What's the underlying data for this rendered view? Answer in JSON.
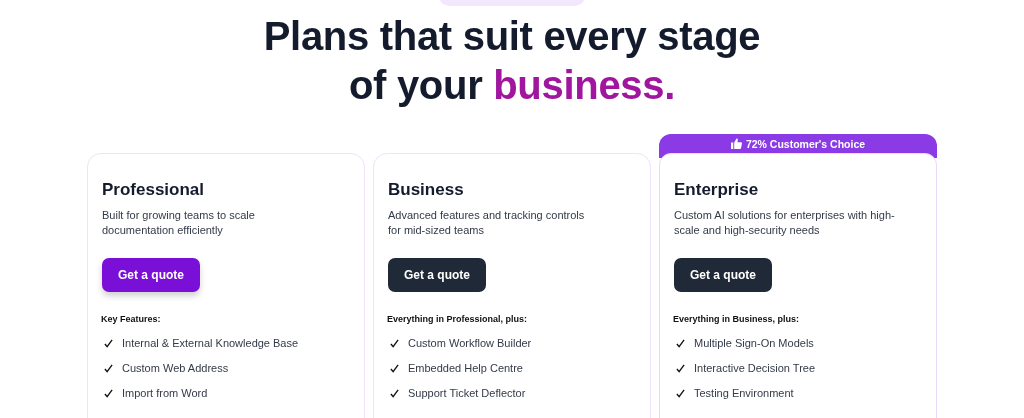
{
  "heading": {
    "line1": "Plans that suit every stage",
    "line2_prefix": "of your",
    "line2_accent": "business."
  },
  "plans": [
    {
      "name": "Professional",
      "description": "Built for growing teams to scale documentation efficiently",
      "button": "Get a quote",
      "primary": true,
      "features_title": "Key Features:",
      "features": [
        "Internal & External Knowledge Base",
        "Custom Web Address",
        "Import from Word"
      ]
    },
    {
      "name": "Business",
      "description": "Advanced features and tracking controls for mid-sized teams",
      "button": "Get a quote",
      "primary": false,
      "features_title": "Everything in Professional, plus:",
      "features": [
        "Custom Workflow Builder",
        "Embedded Help Centre",
        "Support Ticket Deflector"
      ]
    },
    {
      "name": "Enterprise",
      "ribbon": "72% Customer's Choice",
      "description": "Custom AI solutions for enterprises with high-scale and high-security needs",
      "button": "Get a quote",
      "primary": false,
      "features_title": "Everything in Business, plus:",
      "features": [
        "Multiple Sign-On Models",
        "Interactive Decision Tree",
        "Testing Environment"
      ]
    }
  ]
}
